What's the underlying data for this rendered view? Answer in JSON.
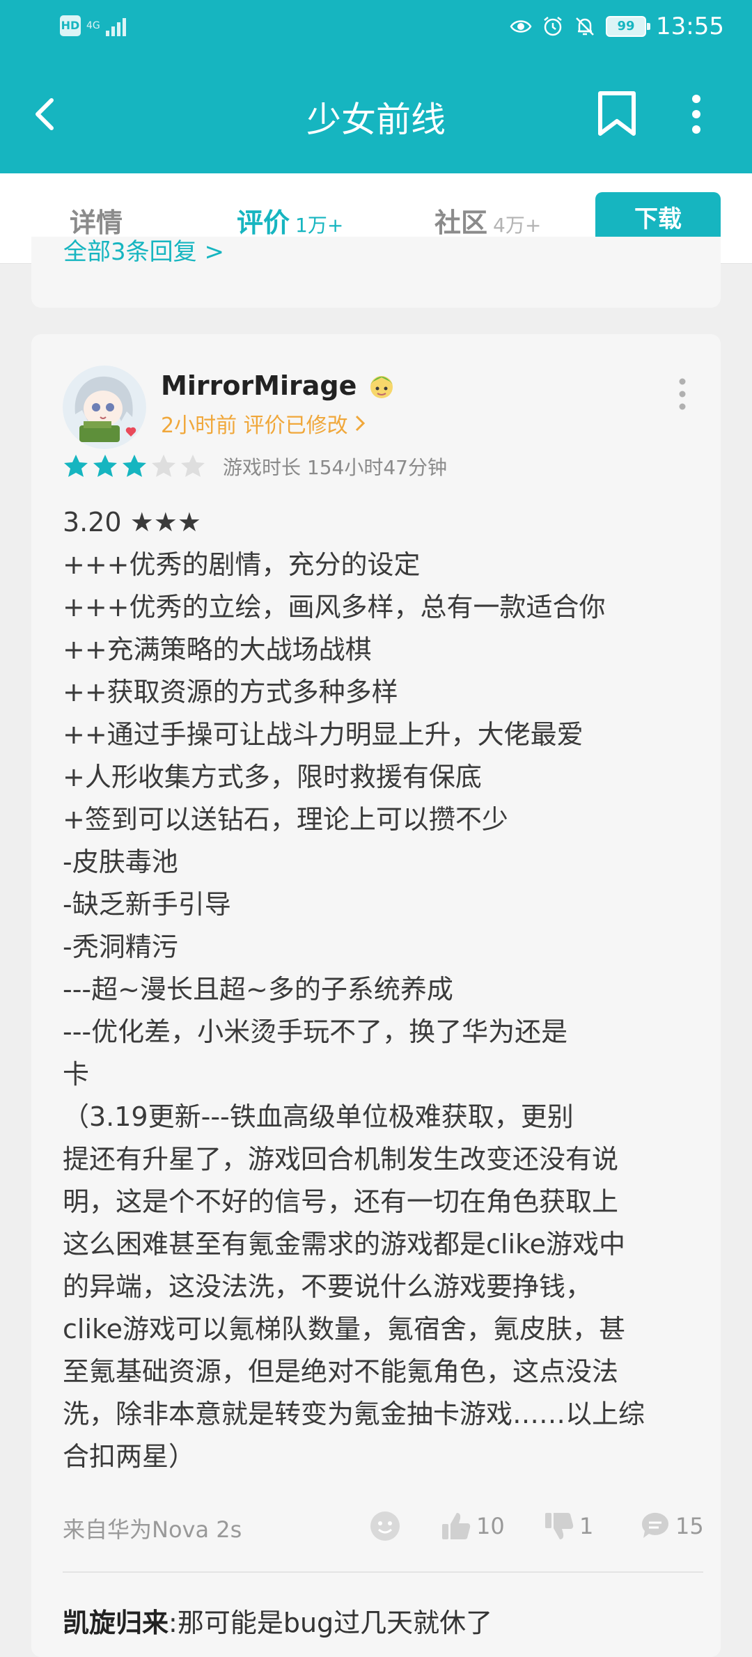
{
  "status_bar": {
    "hd": "HD",
    "network": "4G",
    "battery": "99",
    "time": "13:55"
  },
  "header": {
    "title": "少女前线"
  },
  "tabs": [
    {
      "label": "详情",
      "count": ""
    },
    {
      "label": "评价",
      "count": "1万+"
    },
    {
      "label": "社区",
      "count": "4万+"
    }
  ],
  "download_label": "下载",
  "previous_card": {
    "link_text": "全部3条回复 >"
  },
  "review": {
    "username": "MirrorMirage",
    "meta": "2小时前 评价已修改",
    "rating": 3,
    "max_rating": 5,
    "playtime": "游戏时长 154小时47分钟",
    "lines": [
      "3.20 ★★★",
      "+++优秀的剧情，充分的设定",
      "+++优秀的立绘，画风多样，总有一款适合你",
      "++充满策略的大战场战棋",
      "++获取资源的方式多种多样",
      "++通过手操可让战斗力明显上升，大佬最爱",
      "+人形收集方式多，限时救援有保底",
      "+签到可以送钻石，理论上可以攒不少",
      "-皮肤毒池",
      "-缺乏新手引导",
      "-秃洞精污",
      "---超~漫长且超~多的子系统养成",
      "---优化差，小米烫手玩不了，换了华为还是",
      "卡",
      "（3.19更新---铁血高级单位极难获取，更别",
      "提还有升星了，游戏回合机制发生改变还没有说",
      "明，这是个不好的信号，还有一切在角色获取上",
      "这么困难甚至有氪金需求的游戏都是clike游戏中",
      "的异端，这没法洗，不要说什么游戏要挣钱，",
      "clike游戏可以氪梯队数量，氪宿舍，氪皮肤，甚",
      "至氪基础资源，但是绝对不能氪角色，这点没法",
      "洗，除非本意就是转变为氪金抽卡游戏……以上综",
      "合扣两星）"
    ],
    "device": "来自华为Nova 2s",
    "likes": "10",
    "dislikes": "1",
    "comments": "15"
  },
  "reply": {
    "author": "凯旋归来",
    "text": ":那可能是bug过几天就休了"
  },
  "colors": {
    "accent": "#16b5c0",
    "meta_orange": "#f0a73a"
  }
}
